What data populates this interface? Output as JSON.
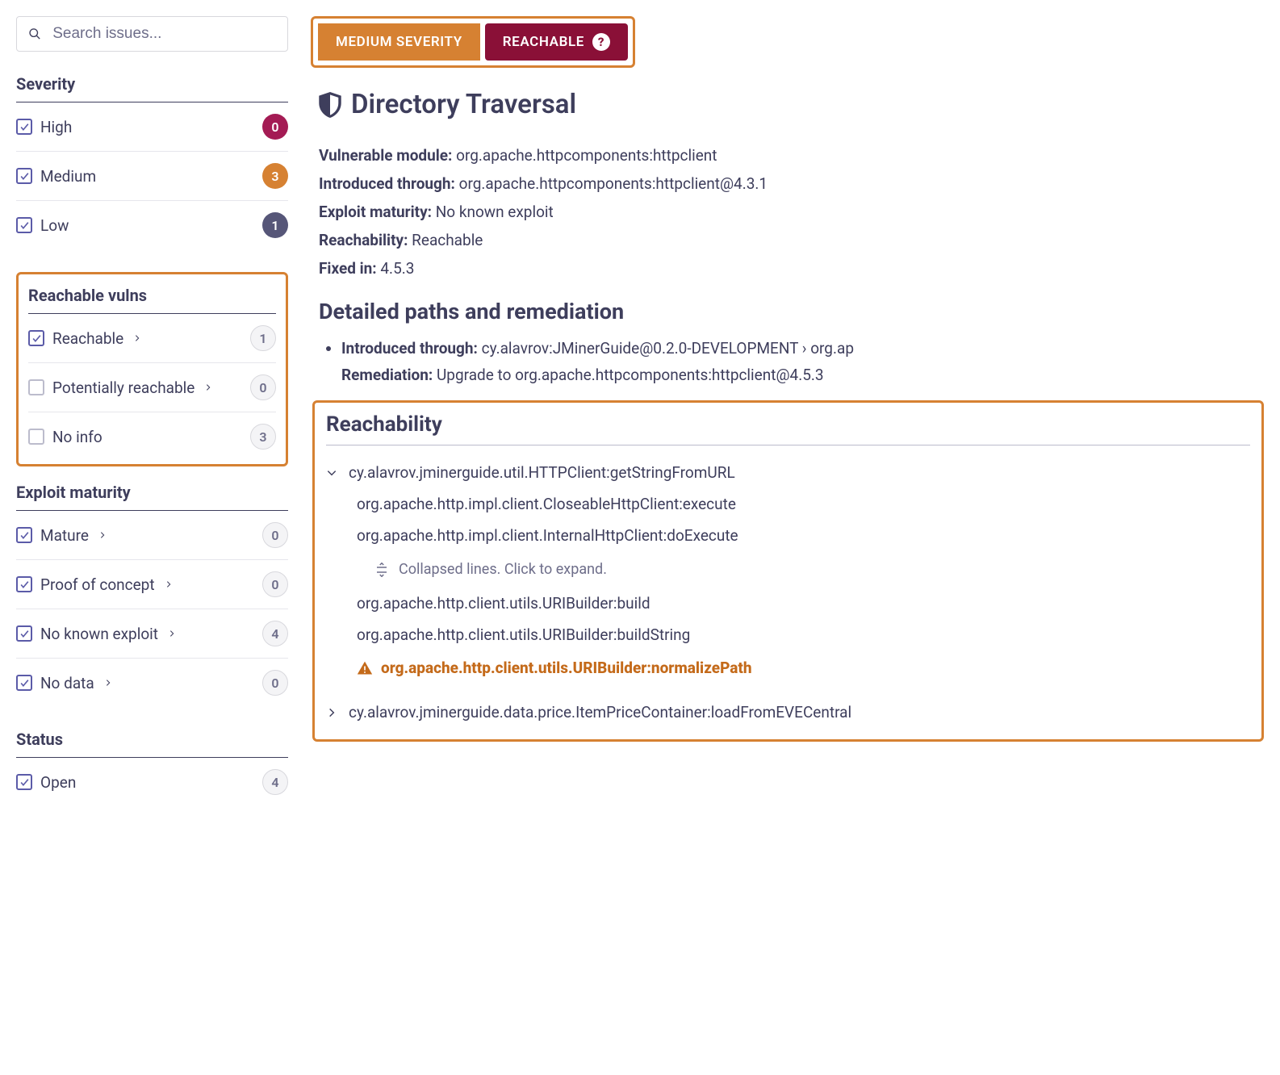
{
  "search": {
    "placeholder": "Search issues..."
  },
  "filters": {
    "severity": {
      "title": "Severity",
      "items": [
        {
          "label": "High",
          "count": "0",
          "color": "high",
          "checked": true
        },
        {
          "label": "Medium",
          "count": "3",
          "color": "medium",
          "checked": true
        },
        {
          "label": "Low",
          "count": "1",
          "color": "low",
          "checked": true
        }
      ]
    },
    "reachable": {
      "title": "Reachable vulns",
      "items": [
        {
          "label": "Reachable",
          "count": "1",
          "checked": true,
          "chevron": true
        },
        {
          "label": "Potentially reachable",
          "count": "0",
          "checked": false,
          "chevron": true
        },
        {
          "label": "No info",
          "count": "3",
          "checked": false,
          "chevron": false
        }
      ]
    },
    "exploit": {
      "title": "Exploit maturity",
      "items": [
        {
          "label": "Mature",
          "count": "0",
          "checked": true,
          "chevron": true
        },
        {
          "label": "Proof of concept",
          "count": "0",
          "checked": true,
          "chevron": true
        },
        {
          "label": "No known exploit",
          "count": "4",
          "checked": true,
          "chevron": true
        },
        {
          "label": "No data",
          "count": "0",
          "checked": true,
          "chevron": true
        }
      ]
    },
    "status": {
      "title": "Status",
      "items": [
        {
          "label": "Open",
          "count": "4",
          "checked": true,
          "chevron": false
        }
      ]
    }
  },
  "detail": {
    "severity_pill": "MEDIUM SEVERITY",
    "reach_pill": "REACHABLE",
    "title": "Directory Traversal",
    "meta": {
      "vulnerable_module_label": "Vulnerable module:",
      "vulnerable_module": "org.apache.httpcomponents:httpclient",
      "introduced_label": "Introduced through:",
      "introduced": "org.apache.httpcomponents:httpclient@4.3.1",
      "exploit_label": "Exploit maturity:",
      "exploit": "No known exploit",
      "reach_label": "Reachability:",
      "reach": "Reachable",
      "fixed_label": "Fixed in:",
      "fixed": "4.5.3"
    },
    "paths_title": "Detailed paths and remediation",
    "path": {
      "introduced_label": "Introduced through:",
      "introduced_value": "cy.alavrov:JMinerGuide@0.2.0-DEVELOPMENT › org.ap",
      "remediation_label": "Remediation:",
      "remediation_value": "Upgrade to org.apache.httpcomponents:httpclient@4.5.3"
    },
    "reachability_panel": {
      "title": "Reachability",
      "trace1": {
        "root": "cy.alavrov.jminerguide.util.HTTPClient:getStringFromURL",
        "lines": [
          "org.apache.http.impl.client.CloseableHttpClient:execute",
          "org.apache.http.impl.client.InternalHttpClient:doExecute"
        ],
        "collapsed_hint": "Collapsed lines. Click to expand.",
        "lines2": [
          "org.apache.http.client.utils.URIBuilder:build",
          "org.apache.http.client.utils.URIBuilder:buildString"
        ],
        "warn": "org.apache.http.client.utils.URIBuilder:normalizePath"
      },
      "trace2": {
        "root": "cy.alavrov.jminerguide.data.price.ItemPriceContainer:loadFromEVECentral"
      }
    }
  }
}
